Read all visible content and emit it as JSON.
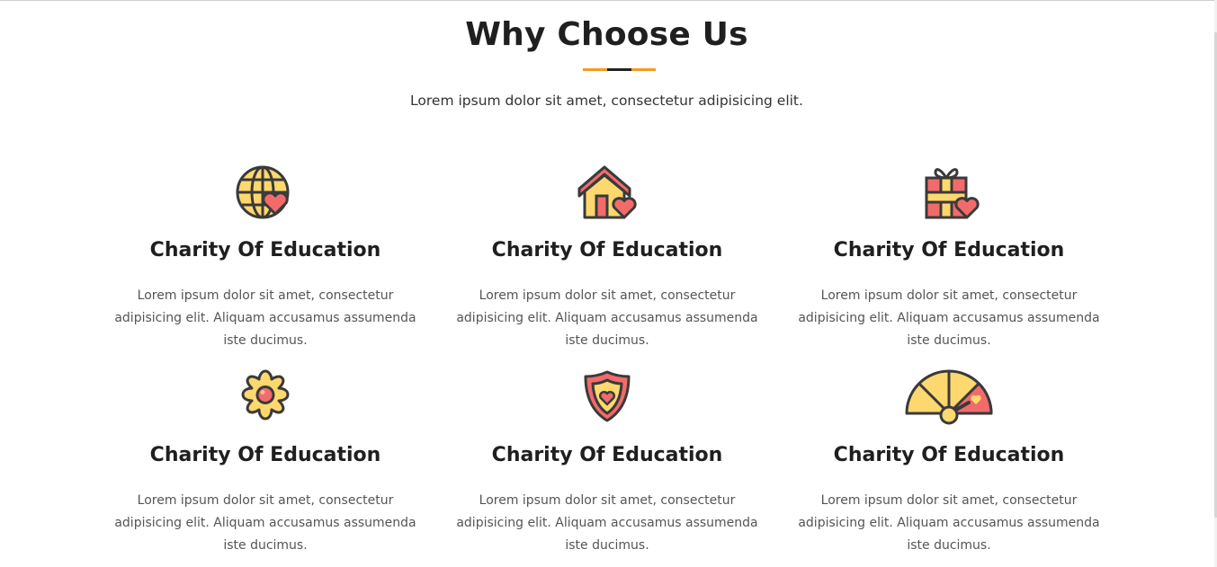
{
  "section": {
    "title": "Why Choose Us",
    "subtitle": "Lorem ipsum dolor sit amet, consectetur adipisicing elit."
  },
  "colors": {
    "accent": "#f39c1f",
    "dark": "#222222",
    "icon_yellow": "#fdd86e",
    "icon_red": "#f26b6b",
    "icon_outline": "#3a3a3a"
  },
  "features": [
    {
      "icon": "globe-heart-icon",
      "title": "Charity Of Education",
      "text": "Lorem ipsum dolor sit amet, consectetur adipisicing elit. Aliquam accusamus assumenda iste ducimus."
    },
    {
      "icon": "house-heart-icon",
      "title": "Charity Of Education",
      "text": "Lorem ipsum dolor sit amet, consectetur adipisicing elit. Aliquam accusamus assumenda iste ducimus."
    },
    {
      "icon": "gift-heart-icon",
      "title": "Charity Of Education",
      "text": "Lorem ipsum dolor sit amet, consectetur adipisicing elit. Aliquam accusamus assumenda iste ducimus."
    },
    {
      "icon": "flower-icon",
      "title": "Charity Of Education",
      "text": "Lorem ipsum dolor sit amet, consectetur adipisicing elit. Aliquam accusamus assumenda iste ducimus."
    },
    {
      "icon": "shield-heart-icon",
      "title": "Charity Of Education",
      "text": "Lorem ipsum dolor sit amet, consectetur adipisicing elit. Aliquam accusamus assumenda iste ducimus."
    },
    {
      "icon": "gauge-heart-icon",
      "title": "Charity Of Education",
      "text": "Lorem ipsum dolor sit amet, consectetur adipisicing elit. Aliquam accusamus assumenda iste ducimus."
    }
  ]
}
